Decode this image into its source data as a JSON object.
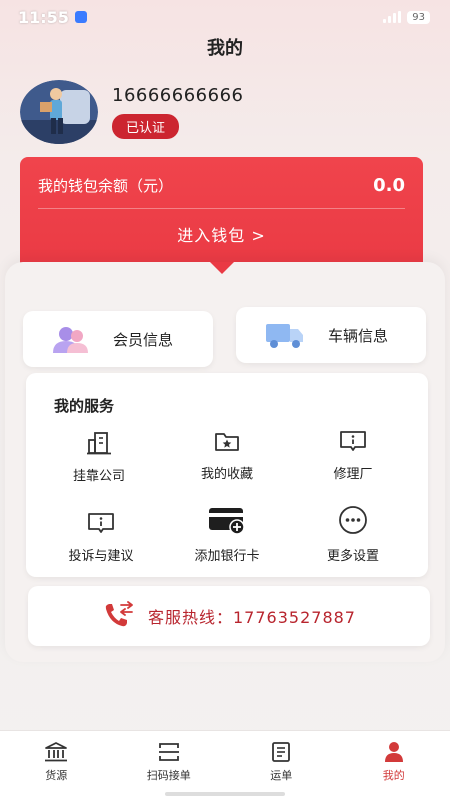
{
  "status": {
    "time": "11:55",
    "battery": "93"
  },
  "page": {
    "title": "我的"
  },
  "profile": {
    "phone": "16666666666",
    "badge": "已认证"
  },
  "wallet": {
    "label": "我的钱包余额（元）",
    "amount": "0.0",
    "enter": "进入钱包 >"
  },
  "quick": {
    "member": "会员信息",
    "vehicle": "车辆信息"
  },
  "services": {
    "title": "我的服务",
    "items": [
      {
        "label": "挂靠公司",
        "icon": "building-icon"
      },
      {
        "label": "我的收藏",
        "icon": "favorites-folder-icon"
      },
      {
        "label": "修理厂",
        "icon": "info-message-icon"
      },
      {
        "label": "投诉与建议",
        "icon": "feedback-message-icon"
      },
      {
        "label": "添加银行卡",
        "icon": "bank-card-add-icon"
      },
      {
        "label": "更多设置",
        "icon": "more-dots-icon"
      }
    ]
  },
  "hotline": {
    "text": "客服热线：17763527887"
  },
  "tabs": [
    {
      "label": "货源",
      "icon": "bank-icon",
      "active": false
    },
    {
      "label": "扫码接单",
      "icon": "scan-icon",
      "active": false
    },
    {
      "label": "运单",
      "icon": "document-icon",
      "active": false
    },
    {
      "label": "我的",
      "icon": "person-icon",
      "active": true
    }
  ],
  "colors": {
    "accent": "#e8414a",
    "badge": "#cc2530",
    "hotline": "#b8252e",
    "tab_active": "#d23a3a"
  }
}
